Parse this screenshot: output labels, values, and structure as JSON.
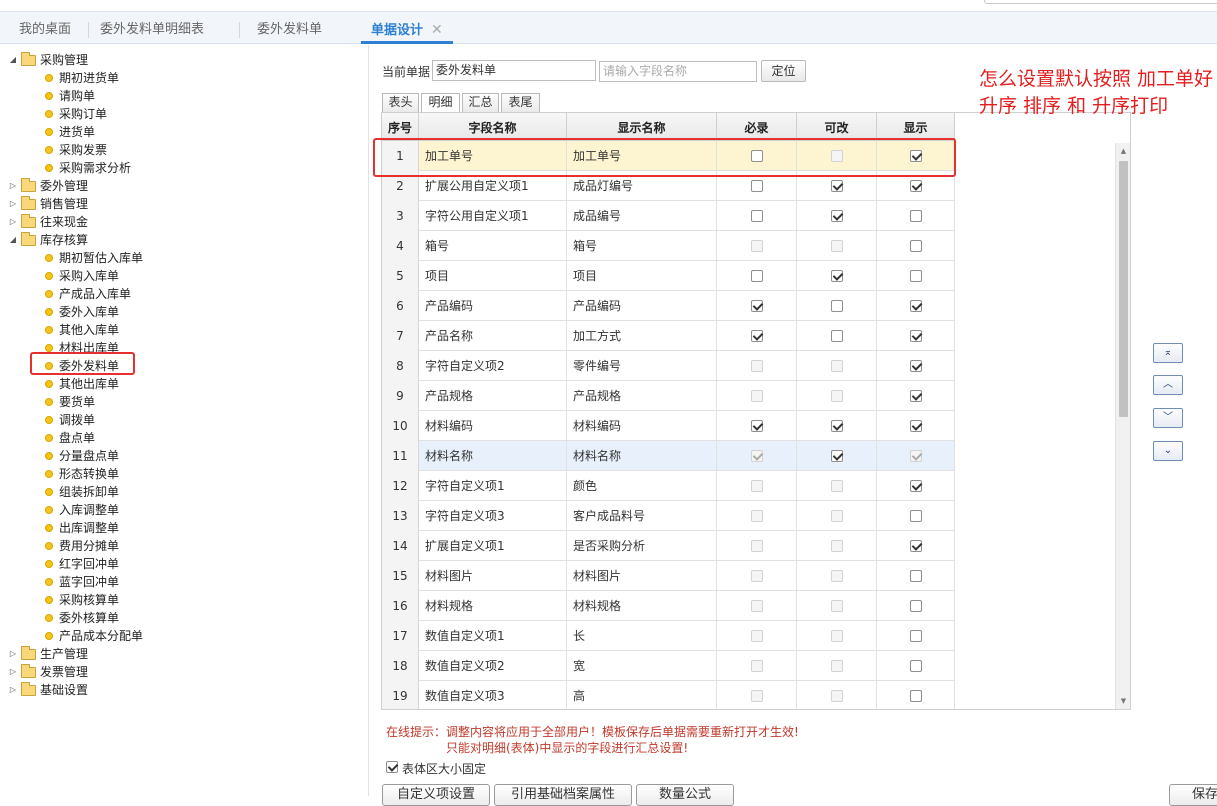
{
  "tabs": [
    {
      "label": "我的桌面"
    },
    {
      "label": "委外发料单明细表"
    },
    {
      "label": "委外发料单"
    },
    {
      "label": "单据设计",
      "active": true,
      "close": "✕"
    }
  ],
  "tree": {
    "groups": [
      {
        "label": "采购管理",
        "expanded": true,
        "items": [
          "期初进货单",
          "请购单",
          "采购订单",
          "进货单",
          "采购发票",
          "采购需求分析"
        ]
      },
      {
        "label": "委外管理",
        "expanded": false
      },
      {
        "label": "销售管理",
        "expanded": false
      },
      {
        "label": "往来现金",
        "expanded": false
      },
      {
        "label": "库存核算",
        "expanded": true,
        "items": [
          "期初暂估入库单",
          "采购入库单",
          "产成品入库单",
          "委外入库单",
          "其他入库单",
          "材料出库单",
          "委外发料单",
          "其他出库单",
          "要货单",
          "调拨单",
          "盘点单",
          "分量盘点单",
          "形态转换单",
          "组装拆卸单",
          "入库调整单",
          "出库调整单",
          "费用分摊单",
          "红字回冲单",
          "蓝字回冲单",
          "采购核算单",
          "委外核算单",
          "产品成本分配单"
        ]
      },
      {
        "label": "生产管理",
        "expanded": false
      },
      {
        "label": "发票管理",
        "expanded": false
      },
      {
        "label": "基础设置",
        "expanded": false
      }
    ],
    "highlighted": "委外发料单"
  },
  "form": {
    "current_label": "当前单据",
    "current_value": "委外发料单",
    "search_placeholder": "请输入字段名称",
    "locate_label": "定位"
  },
  "subtabs": [
    "表头",
    "明细",
    "汇总",
    "表尾"
  ],
  "active_subtab": "明细",
  "grid": {
    "headers": [
      "序号",
      "字段名称",
      "显示名称",
      "必录",
      "可改",
      "显示"
    ],
    "rows": [
      {
        "no": "1",
        "field": "加工单号",
        "display": "加工单号",
        "req": [
          false,
          false
        ],
        "edit": [
          false,
          true
        ],
        "show": [
          true,
          false
        ]
      },
      {
        "no": "2",
        "field": "扩展公用自定义项1",
        "display": "成品灯编号",
        "req": [
          false,
          false
        ],
        "edit": [
          true,
          false
        ],
        "show": [
          true,
          false
        ]
      },
      {
        "no": "3",
        "field": "字符公用自定义项1",
        "display": "成品编号",
        "req": [
          false,
          false
        ],
        "edit": [
          true,
          false
        ],
        "show": [
          false,
          false
        ]
      },
      {
        "no": "4",
        "field": "箱号",
        "display": "箱号",
        "req": [
          false,
          true
        ],
        "edit": [
          false,
          true
        ],
        "show": [
          false,
          false
        ]
      },
      {
        "no": "5",
        "field": "项目",
        "display": "项目",
        "req": [
          false,
          false
        ],
        "edit": [
          true,
          false
        ],
        "show": [
          false,
          false
        ]
      },
      {
        "no": "6",
        "field": "产品编码",
        "display": "产品编码",
        "req": [
          true,
          false
        ],
        "edit": [
          false,
          false
        ],
        "show": [
          true,
          false
        ]
      },
      {
        "no": "7",
        "field": "产品名称",
        "display": "加工方式",
        "req": [
          true,
          false
        ],
        "edit": [
          false,
          false
        ],
        "show": [
          true,
          false
        ]
      },
      {
        "no": "8",
        "field": "字符自定义项2",
        "display": "零件编号",
        "req": [
          false,
          true
        ],
        "edit": [
          false,
          true
        ],
        "show": [
          true,
          false
        ]
      },
      {
        "no": "9",
        "field": "产品规格",
        "display": "产品规格",
        "req": [
          false,
          true
        ],
        "edit": [
          false,
          true
        ],
        "show": [
          true,
          false
        ]
      },
      {
        "no": "10",
        "field": "材料编码",
        "display": "材料编码",
        "req": [
          true,
          false
        ],
        "edit": [
          true,
          false
        ],
        "show": [
          true,
          false
        ]
      },
      {
        "no": "11",
        "field": "材料名称",
        "display": "材料名称",
        "req": [
          true,
          true
        ],
        "edit": [
          true,
          false
        ],
        "show": [
          true,
          true
        ]
      },
      {
        "no": "12",
        "field": "字符自定义项1",
        "display": "颜色",
        "req": [
          false,
          true
        ],
        "edit": [
          false,
          true
        ],
        "show": [
          true,
          false
        ]
      },
      {
        "no": "13",
        "field": "字符自定义项3",
        "display": "客户成品料号",
        "req": [
          false,
          true
        ],
        "edit": [
          false,
          true
        ],
        "show": [
          false,
          false
        ]
      },
      {
        "no": "14",
        "field": "扩展自定义项1",
        "display": "是否采购分析",
        "req": [
          false,
          true
        ],
        "edit": [
          false,
          true
        ],
        "show": [
          true,
          false
        ]
      },
      {
        "no": "15",
        "field": "材料图片",
        "display": "材料图片",
        "req": [
          false,
          true
        ],
        "edit": [
          false,
          true
        ],
        "show": [
          false,
          false
        ]
      },
      {
        "no": "16",
        "field": "材料规格",
        "display": "材料规格",
        "req": [
          false,
          true
        ],
        "edit": [
          false,
          true
        ],
        "show": [
          false,
          false
        ]
      },
      {
        "no": "17",
        "field": "数值自定义项1",
        "display": "长",
        "req": [
          false,
          true
        ],
        "edit": [
          false,
          true
        ],
        "show": [
          false,
          false
        ]
      },
      {
        "no": "18",
        "field": "数值自定义项2",
        "display": "宽",
        "req": [
          false,
          true
        ],
        "edit": [
          false,
          true
        ],
        "show": [
          false,
          false
        ]
      },
      {
        "no": "19",
        "field": "数值自定义项3",
        "display": "高",
        "req": [
          false,
          true
        ],
        "edit": [
          false,
          true
        ],
        "show": [
          false,
          false
        ]
      }
    ],
    "highlight_row": 0,
    "selected_row": 10
  },
  "move_buttons": {
    "top": {
      "label": "⌅",
      "icon": "move-top-icon"
    },
    "up": {
      "label": "︿",
      "icon": "move-up-icon"
    },
    "down": {
      "label": "﹀",
      "icon": "move-down-icon"
    },
    "bottom": {
      "label": "⌄",
      "icon": "move-bottom-icon"
    }
  },
  "annotation": "怎么设置默认按照 加工单好 升序 排序  和 升序打印",
  "tips": {
    "line1": "在线提示：调整内容将应用于全部用户！模板保存后单据需要重新打开才生效!",
    "line2": "只能对明细(表体)中显示的字段进行汇总设置!"
  },
  "fixed_size": {
    "label": "表体区大小固定",
    "checked": true
  },
  "bottom_buttons": [
    "自定义项设置",
    "引用基础档案属性",
    "数量公式",
    "保存"
  ],
  "colors": {
    "accent": "#2f80d1",
    "highlight_row": "#fdf5d2",
    "selected_row": "#e8f1fb",
    "red": "#e53030"
  }
}
